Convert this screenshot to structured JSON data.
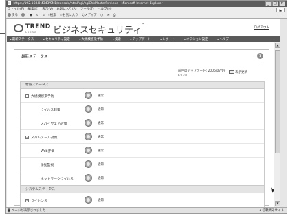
{
  "window": {
    "title": "https://192.168.0.4343/SMB/console/html/cgi/cgiChkMasterPwd.exe - Microsoft Internet Explorer",
    "buttons": [
      "_",
      "□",
      "×"
    ]
  },
  "menubar": {
    "items": [
      "ファイル(F)",
      "編集(E)",
      "表示(V)",
      "お気に入り(A)",
      "ツール(T)",
      "ヘルプ(H)"
    ]
  },
  "toolbar": {
    "items": [
      "戻る",
      "検索",
      "お気に入り",
      "メディア"
    ]
  },
  "brand": {
    "trend": "TREND",
    "micro": "MICRO",
    "title": "ビジネスセキュリティ",
    "tm": "™",
    "logout": "ログアウト"
  },
  "nav": {
    "items": [
      "最新ステータス",
      "セキュリティ設定",
      "大規模感染予防",
      "検索",
      "アップデート",
      "レポート",
      "オプション設定",
      "ヘルプ"
    ]
  },
  "pane": {
    "title": "最新ステータス",
    "help": "?",
    "update_label": "前回のアップデート: 2006/07/09",
    "update_time": "6:17:07",
    "refresh": "表示更新"
  },
  "threat_section": {
    "title": "脅威ステータス",
    "rows": [
      {
        "label": "大規模感染予防",
        "status": "通常",
        "expandable": true
      },
      {
        "label": "ウイルス対策",
        "status": "通常",
        "expandable": false
      },
      {
        "label": "スパイウェア対策",
        "status": "通常",
        "expandable": false
      },
      {
        "label": "スパムメール対策",
        "status": "通常",
        "expandable": true
      },
      {
        "label": "Web評価",
        "status": "通常",
        "expandable": false
      },
      {
        "label": "挙動監視",
        "status": "通常",
        "expandable": false
      },
      {
        "label": "ネットワークウイルス",
        "status": "通常",
        "expandable": false
      }
    ]
  },
  "system_section": {
    "title": "システムステータス",
    "rows": [
      {
        "label": "ライセンス",
        "status": "通常",
        "expandable": true
      }
    ]
  },
  "statusbar": {
    "left": "ページが表示されました",
    "zone": "信頼済みサイト"
  }
}
